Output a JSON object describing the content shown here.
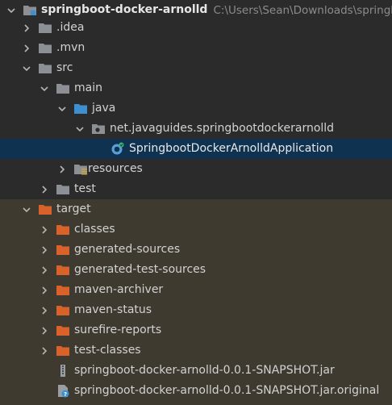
{
  "colors": {
    "background": "#2b2b2b",
    "excluded_background": "#3f3a30",
    "selected_background": "#0f3251",
    "folder_gray": "#8c9094",
    "folder_source_blue": "#3d8fcf",
    "folder_excluded_orange": "#d9622b",
    "spring_green": "#3cb371"
  },
  "tree": {
    "rows": [
      {
        "label": "springboot-docker-arnolld",
        "path": "C:\\Users\\Sean\\Downloads\\springbo",
        "icon": "module-folder-icon",
        "expanded": true
      },
      {
        "label": ".idea",
        "icon": "folder-icon",
        "expanded": false
      },
      {
        "label": ".mvn",
        "icon": "folder-icon",
        "expanded": false
      },
      {
        "label": "src",
        "icon": "folder-icon",
        "expanded": true
      },
      {
        "label": "main",
        "icon": "folder-icon",
        "expanded": true
      },
      {
        "label": "java",
        "icon": "source-folder-icon",
        "expanded": true
      },
      {
        "label": "net.javaguides.springbootdockerarnolld",
        "icon": "package-icon",
        "expanded": true
      },
      {
        "label": "SpringbootDockerArnolldApplication",
        "icon": "spring-boot-class-icon",
        "selected": true
      },
      {
        "label": "resources",
        "icon": "resources-folder-icon",
        "expanded": false
      },
      {
        "label": "test",
        "icon": "folder-icon",
        "expanded": false
      },
      {
        "label": "target",
        "icon": "excluded-folder-icon",
        "expanded": true
      },
      {
        "label": "classes",
        "icon": "excluded-folder-icon",
        "expanded": false
      },
      {
        "label": "generated-sources",
        "icon": "excluded-folder-icon",
        "expanded": false
      },
      {
        "label": "generated-test-sources",
        "icon": "excluded-folder-icon",
        "expanded": false
      },
      {
        "label": "maven-archiver",
        "icon": "excluded-folder-icon",
        "expanded": false
      },
      {
        "label": "maven-status",
        "icon": "excluded-folder-icon",
        "expanded": false
      },
      {
        "label": "surefire-reports",
        "icon": "excluded-folder-icon",
        "expanded": false
      },
      {
        "label": "test-classes",
        "icon": "excluded-folder-icon",
        "expanded": false
      },
      {
        "label": "springboot-docker-arnolld-0.0.1-SNAPSHOT.jar",
        "icon": "jar-file-icon"
      },
      {
        "label": "springboot-docker-arnolld-0.0.1-SNAPSHOT.jar.original",
        "icon": "unknown-file-icon"
      }
    ]
  }
}
